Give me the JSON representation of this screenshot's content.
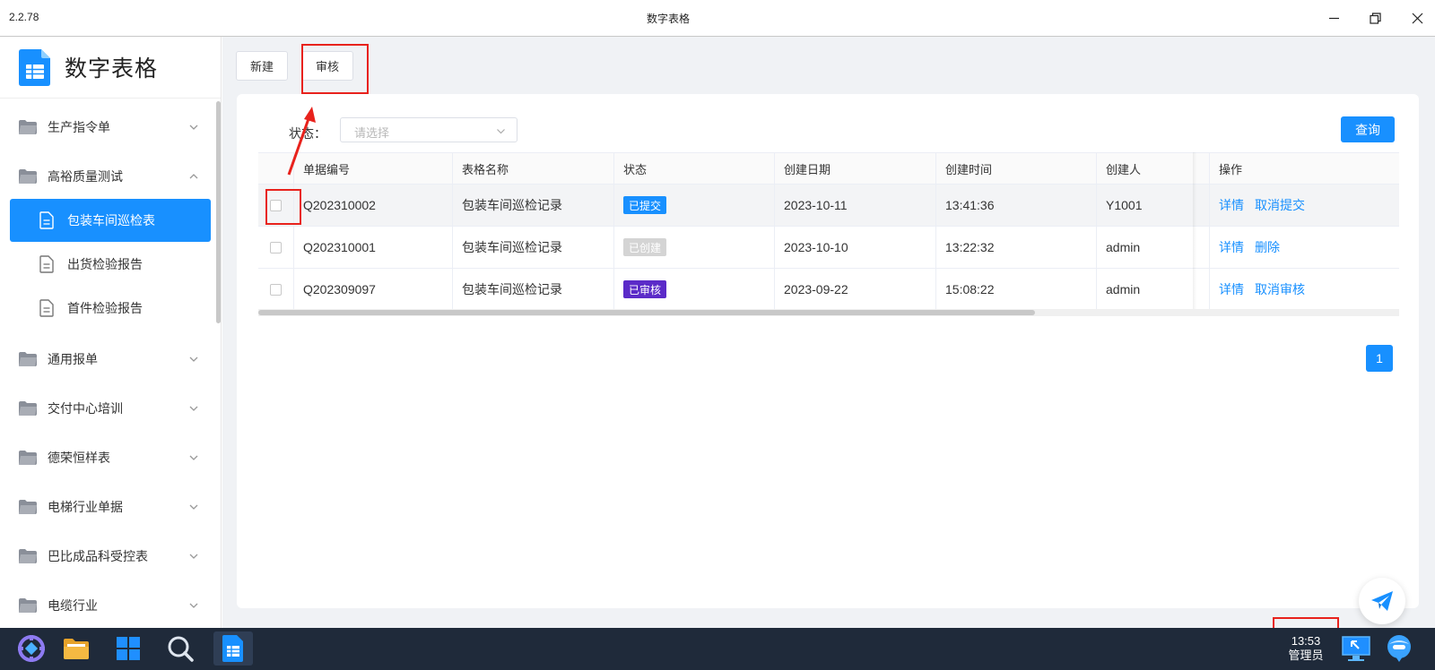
{
  "window": {
    "version": "2.2.78",
    "title": "数字表格"
  },
  "sidebar": {
    "brand": "数字表格",
    "groups": [
      {
        "label": "生产指令单",
        "expanded": false
      },
      {
        "label": "高裕质量测试",
        "expanded": true,
        "children": [
          "包装车间巡检表",
          "出货检验报告",
          "首件检验报告"
        ]
      },
      {
        "label": "通用报单",
        "expanded": false
      },
      {
        "label": "交付中心培训",
        "expanded": false
      },
      {
        "label": "德荣恒样表",
        "expanded": false
      },
      {
        "label": "电梯行业单据",
        "expanded": false
      },
      {
        "label": "巴比成品科受控表",
        "expanded": false
      },
      {
        "label": "电缆行业",
        "expanded": false
      }
    ]
  },
  "toolbar": {
    "new_label": "新建",
    "review_label": "审核"
  },
  "filter": {
    "status_label": "状态：",
    "status_placeholder": "请选择",
    "query_label": "查询"
  },
  "table": {
    "columns": [
      "单据编号",
      "表格名称",
      "状态",
      "创建日期",
      "创建时间",
      "创建人",
      "操作"
    ],
    "rows": [
      {
        "id": "Q202310002",
        "name": "包装车间巡检记录",
        "status": "已提交",
        "status_color": "#1890ff",
        "date": "2023-10-11",
        "time": "13:41:36",
        "creator": "Y1001",
        "actions": [
          "详情",
          "取消提交"
        ]
      },
      {
        "id": "Q202310001",
        "name": "包装车间巡检记录",
        "status": "已创建",
        "status_color": "#d4d4d4",
        "date": "2023-10-10",
        "time": "13:22:32",
        "creator": "admin",
        "actions": [
          "详情",
          "删除"
        ]
      },
      {
        "id": "Q202309097",
        "name": "包装车间巡检记录",
        "status": "已审核",
        "status_color": "#5b2bc8",
        "date": "2023-09-22",
        "time": "15:08:22",
        "creator": "admin",
        "actions": [
          "详情",
          "取消审核"
        ]
      }
    ]
  },
  "pagination": {
    "current": "1"
  },
  "taskbar": {
    "time": "13:53",
    "user": "管理员"
  },
  "colors": {
    "accent": "#1890ff",
    "annotation": "#e8221c",
    "taskbar": "#1f2a3a"
  }
}
